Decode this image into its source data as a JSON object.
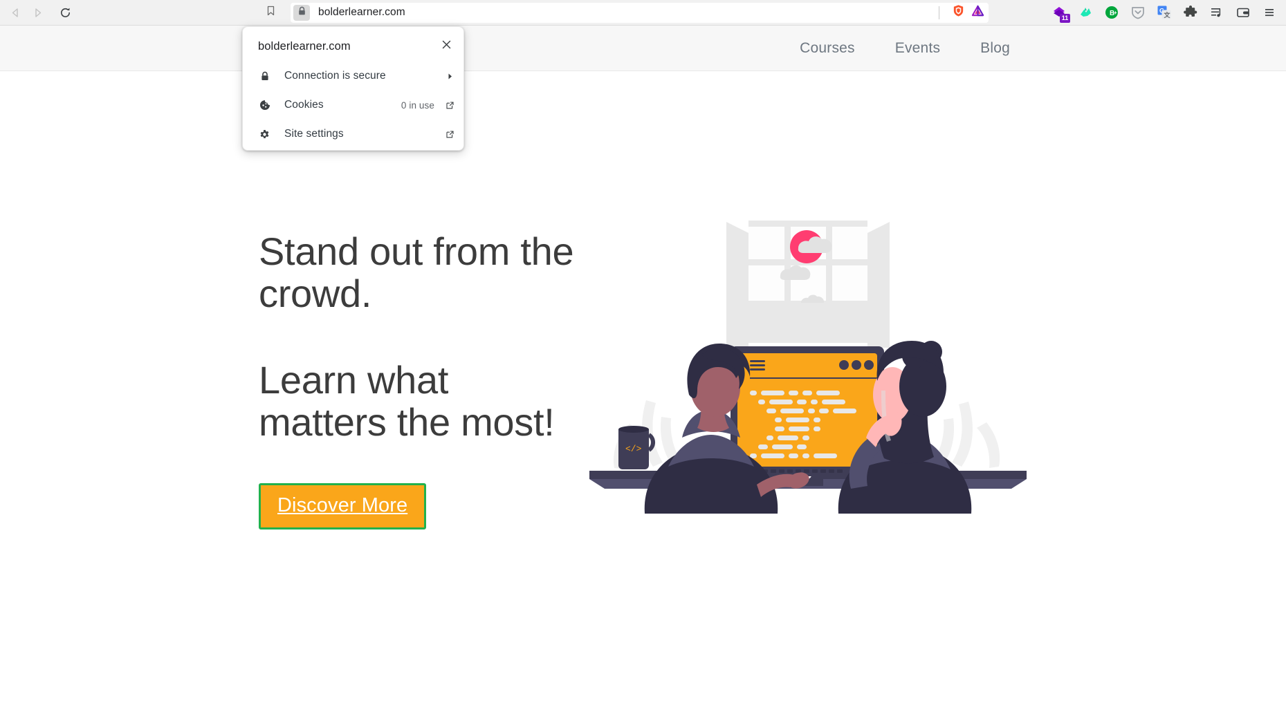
{
  "browser": {
    "back_icon": "back-arrow-icon",
    "forward_icon": "forward-arrow-icon",
    "reload_icon": "reload-icon",
    "bookmark_icon": "bookmark-icon",
    "lock_icon": "lock-icon",
    "url": "bolderlearner.com",
    "urlbar_icons": [
      "brave-shield-icon",
      "brave-rewards-triangle-icon"
    ],
    "extension_icons": [
      {
        "name": "purple-extension-icon",
        "badge": "11"
      },
      {
        "name": "teal-extension-icon",
        "badge": ""
      },
      {
        "name": "bitwarden-plus-icon",
        "badge": ""
      },
      {
        "name": "pocket-shield-icon",
        "badge": ""
      },
      {
        "name": "google-translate-icon",
        "badge": ""
      },
      {
        "name": "extensions-puzzle-icon",
        "badge": ""
      },
      {
        "name": "media-playlist-icon",
        "badge": ""
      },
      {
        "name": "wallet-icon",
        "badge": ""
      },
      {
        "name": "browser-menu-icon",
        "badge": ""
      }
    ]
  },
  "site_panel": {
    "title": "bolderlearner.com",
    "close_label": "×",
    "rows": [
      {
        "icon": "lock-icon",
        "label": "Connection is secure",
        "meta": "",
        "tail": "chevron-right-icon"
      },
      {
        "icon": "cookie-icon",
        "label": "Cookies",
        "meta": "0 in use",
        "tail": "open-in-new-icon"
      },
      {
        "icon": "gear-icon",
        "label": "Site settings",
        "meta": "",
        "tail": "open-in-new-icon"
      }
    ]
  },
  "site_header": {
    "nav": [
      {
        "label": "Courses"
      },
      {
        "label": "Events"
      },
      {
        "label": "Blog"
      }
    ]
  },
  "hero": {
    "headline_1": "Stand out from the crowd.",
    "headline_2": "Learn what matters the most!",
    "cta_label": "Discover More",
    "illustration_name": "two-people-coding-at-monitor-illustration"
  },
  "colors": {
    "cta_background": "#faa61a",
    "cta_border": "#22b14c",
    "cta_text": "#ffffff",
    "headline_text": "#3c3c3c",
    "nav_text": "#6e7781",
    "site_header_bg": "#f7f7f7",
    "toolbar_bg": "#f1f1f1",
    "illustration_orange": "#faa61a",
    "illustration_dark": "#3f3d56",
    "illustration_pink": "#ff4d7e",
    "illustration_skin": "#ffb7b7",
    "illustration_grey": "#e6e6e6"
  }
}
